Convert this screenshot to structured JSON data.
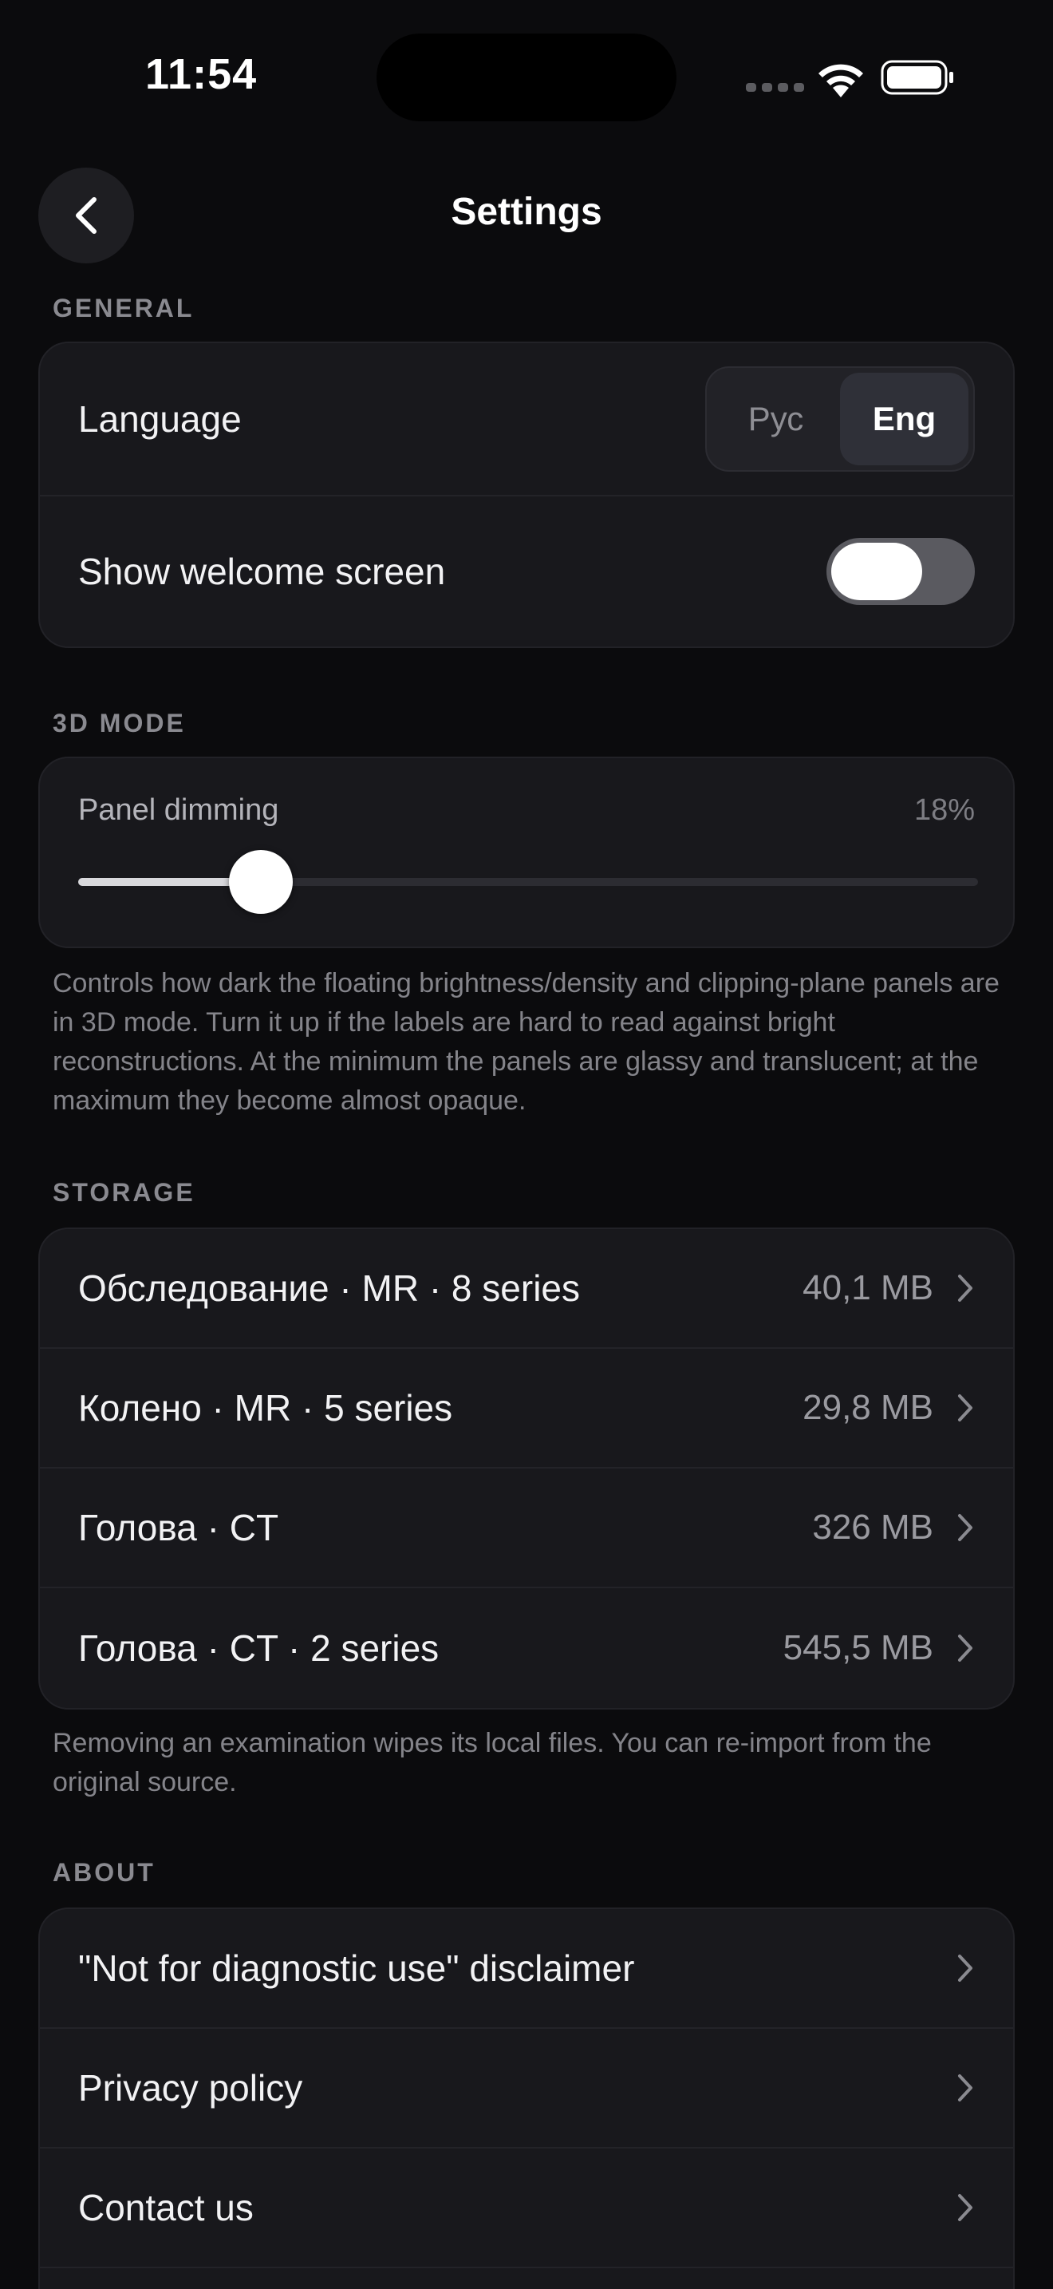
{
  "status": {
    "time": "11:54"
  },
  "nav": {
    "title": "Settings"
  },
  "general": {
    "header": "GENERAL",
    "language_label": "Language",
    "language_options": [
      "Рус",
      "Eng"
    ],
    "language_selected": "Eng",
    "welcome_label": "Show welcome screen"
  },
  "mode3d": {
    "header": "3D MODE",
    "dimming_label": "Panel dimming",
    "dimming_value": "18%",
    "dimming_fraction": 0.18,
    "note": "Controls how dark the floating brightness/density and clipping-plane panels are in 3D mode. Turn it up if the labels are hard to read against bright reconstructions. At the minimum the panels are glassy and translucent; at the maximum they become almost opaque."
  },
  "storage": {
    "header": "STORAGE",
    "items": [
      {
        "label": "Обследование · MR · 8 series",
        "size": "40,1 MB"
      },
      {
        "label": "Колено · MR · 5 series",
        "size": "29,8 MB"
      },
      {
        "label": "Голова · CT",
        "size": "326 MB"
      },
      {
        "label": "Голова · CT · 2 series",
        "size": "545,5 MB"
      }
    ],
    "note": "Removing an examination wipes its local files. You can re-import from the original source."
  },
  "about": {
    "header": "ABOUT",
    "items": [
      {
        "label": "\"Not for diagnostic use\" disclaimer"
      },
      {
        "label": "Privacy policy"
      },
      {
        "label": "Contact us"
      }
    ]
  },
  "icons": {
    "back": "chevron-left-icon",
    "row": "chevron-right-icon",
    "wifi": "wifi-icon",
    "battery": "battery-icon"
  },
  "colors": {
    "background": "#0b0b0d",
    "card": "#18181c",
    "toggle_track": "#5a5a60"
  }
}
